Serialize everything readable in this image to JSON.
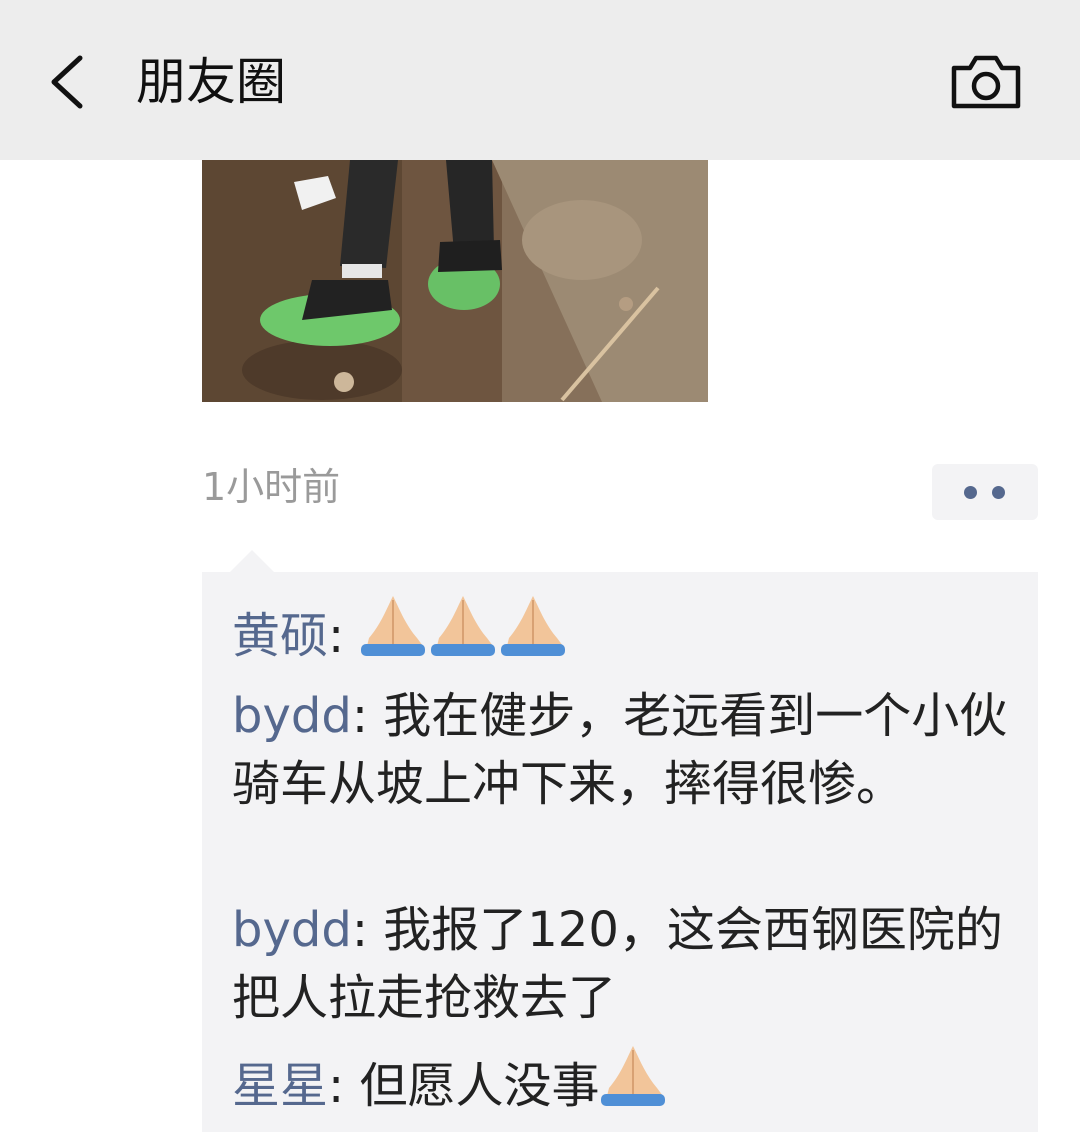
{
  "header": {
    "title": "朋友圈",
    "back_icon": "chevron-left-icon",
    "camera_icon": "camera-icon"
  },
  "post": {
    "timestamp": "1小时前",
    "more_icon": "more-dots-icon"
  },
  "comments": [
    {
      "author": "黄硕",
      "separator": ": ",
      "text": "",
      "emoji_after": "folded-hands-icon",
      "emoji_count": 3
    },
    {
      "author": "bydd",
      "separator": ": ",
      "text": "我在健步，老远看到一个小伙骑车从坡上冲下来，摔得很惨。"
    },
    {
      "author": "bydd",
      "separator": ": ",
      "text": "我报了120，这会西钢医院的把人拉走抢救去了"
    },
    {
      "author": "星星",
      "separator": ": ",
      "text": "但愿人没事",
      "emoji_after": "folded-hands-icon",
      "emoji_count": 1
    }
  ],
  "colors": {
    "header_bg": "#ededed",
    "name_blue": "#55688e",
    "comment_bg": "#f3f3f5",
    "timestamp_gray": "#9a9a9a"
  }
}
